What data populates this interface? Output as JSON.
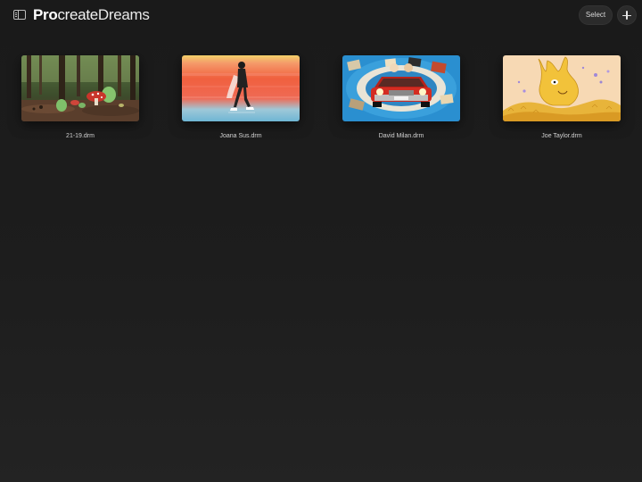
{
  "app": {
    "logo_bold": "Pro",
    "logo_light": "create",
    "logo_dreams": "Dreams"
  },
  "toolbar": {
    "select_label": "Select"
  },
  "gallery": {
    "items": [
      {
        "label": "21-19.drm"
      },
      {
        "label": "Joana Sus.drm"
      },
      {
        "label": "David Milan.drm"
      },
      {
        "label": "Joe Taylor.drm"
      }
    ]
  }
}
